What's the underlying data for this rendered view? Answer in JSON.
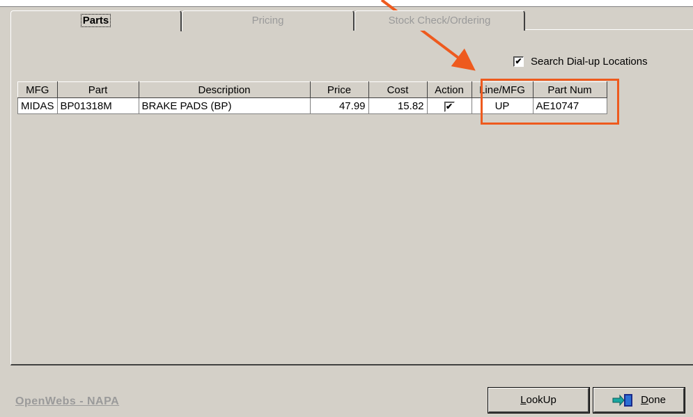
{
  "tabs": [
    {
      "label": "Parts"
    },
    {
      "label": "Pricing"
    },
    {
      "label": "Stock Check/Ordering"
    }
  ],
  "search_dialup": {
    "label": "Search Dial-up Locations",
    "checked": true
  },
  "grid": {
    "columns": [
      "MFG",
      "Part",
      "Description",
      "Price",
      "Cost",
      "Action",
      "Line/MFG",
      "Part Num"
    ],
    "rows": [
      {
        "mfg": "MIDAS",
        "part": "BP01318M",
        "description": "BRAKE PADS (BP)",
        "price": "47.99",
        "cost": "15.82",
        "action_checked": true,
        "line_mfg": "UP",
        "part_num": "AE10747"
      }
    ]
  },
  "footer": {
    "link": "OpenWebs - NAPA"
  },
  "buttons": {
    "lookup": {
      "label_first": "L",
      "label_rest": "ookUp"
    },
    "done": {
      "label_first": "D",
      "label_rest": "one"
    }
  },
  "colors": {
    "annotation": "#ee5a1e",
    "panel": "#d4d0c8"
  },
  "icons": {
    "done": "exit-door-icon",
    "check": "checkmark-icon"
  }
}
